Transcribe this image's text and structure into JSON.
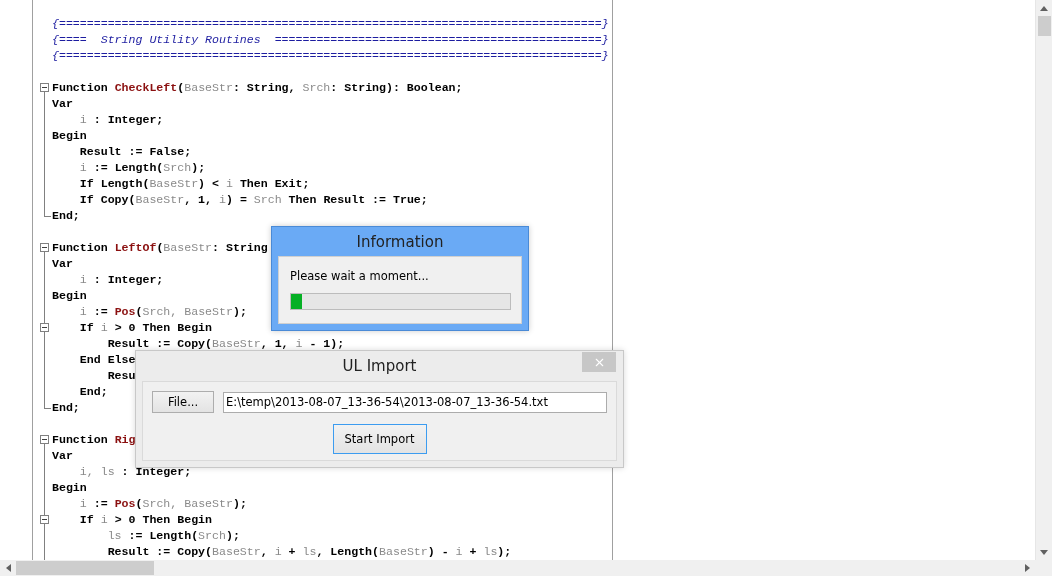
{
  "editor": {
    "lines": [
      {
        "collapsible": false,
        "block_end": false,
        "segments": [
          {
            "kind": "cm",
            "text": "{==============================================================================}"
          }
        ]
      },
      {
        "collapsible": false,
        "block_end": false,
        "segments": [
          {
            "kind": "cm",
            "text": "{====  String Utility Routines  ===============================================}"
          }
        ]
      },
      {
        "collapsible": false,
        "block_end": false,
        "segments": [
          {
            "kind": "cm",
            "text": "{==============================================================================}"
          }
        ]
      },
      {
        "collapsible": false,
        "block_end": false
      },
      {
        "collapsible": true,
        "block_end": false,
        "segments": [
          {
            "kind": "kw",
            "text": "Function "
          },
          {
            "kind": "fn",
            "text": "CheckLeft"
          },
          {
            "kind": "kw",
            "text": "("
          },
          {
            "kind": "id",
            "text": "BaseStr"
          },
          {
            "kind": "kw",
            "text": ": String, "
          },
          {
            "kind": "id",
            "text": "Srch"
          },
          {
            "kind": "kw",
            "text": ": String): Boolean;"
          }
        ]
      },
      {
        "collapsible": false,
        "block_end": false,
        "segments": [
          {
            "kind": "kw",
            "text": "Var"
          }
        ]
      },
      {
        "collapsible": false,
        "block_end": false,
        "segments": [
          {
            "kind": "id",
            "text": "    i"
          },
          {
            "kind": "kw",
            "text": " : Integer;"
          }
        ]
      },
      {
        "collapsible": false,
        "block_end": false,
        "segments": [
          {
            "kind": "kw",
            "text": "Begin"
          }
        ]
      },
      {
        "collapsible": false,
        "block_end": false,
        "segments": [
          {
            "kind": "kw",
            "text": "    Result := False;"
          }
        ]
      },
      {
        "collapsible": false,
        "block_end": false,
        "segments": [
          {
            "kind": "id",
            "text": "    i"
          },
          {
            "kind": "kw",
            "text": " := Length("
          },
          {
            "kind": "id",
            "text": "Srch"
          },
          {
            "kind": "kw",
            "text": ");"
          }
        ]
      },
      {
        "collapsible": false,
        "block_end": false,
        "segments": [
          {
            "kind": "kw",
            "text": "    If Length("
          },
          {
            "kind": "id",
            "text": "BaseStr"
          },
          {
            "kind": "kw",
            "text": ") < "
          },
          {
            "kind": "id",
            "text": "i"
          },
          {
            "kind": "kw",
            "text": " Then Exit;"
          }
        ]
      },
      {
        "collapsible": false,
        "block_end": false,
        "segments": [
          {
            "kind": "kw",
            "text": "    If Copy("
          },
          {
            "kind": "id",
            "text": "BaseStr"
          },
          {
            "kind": "kw",
            "text": ", 1, "
          },
          {
            "kind": "id",
            "text": "i"
          },
          {
            "kind": "kw",
            "text": ") = "
          },
          {
            "kind": "id",
            "text": "Srch"
          },
          {
            "kind": "kw",
            "text": " Then Result := True;"
          }
        ]
      },
      {
        "collapsible": false,
        "block_end": true,
        "segments": [
          {
            "kind": "kw",
            "text": "End;"
          }
        ]
      },
      {
        "collapsible": false,
        "block_end": false
      },
      {
        "collapsible": true,
        "block_end": false,
        "segments": [
          {
            "kind": "kw",
            "text": "Function "
          },
          {
            "kind": "fn",
            "text": "LeftOf"
          },
          {
            "kind": "kw",
            "text": "("
          },
          {
            "kind": "id",
            "text": "BaseStr"
          },
          {
            "kind": "kw",
            "text": ": String"
          }
        ]
      },
      {
        "collapsible": false,
        "block_end": false,
        "segments": [
          {
            "kind": "kw",
            "text": "Var"
          }
        ]
      },
      {
        "collapsible": false,
        "block_end": false,
        "segments": [
          {
            "kind": "id",
            "text": "    i"
          },
          {
            "kind": "kw",
            "text": " : Integer;"
          }
        ]
      },
      {
        "collapsible": false,
        "block_end": false,
        "segments": [
          {
            "kind": "kw",
            "text": "Begin"
          }
        ]
      },
      {
        "collapsible": false,
        "block_end": false,
        "segments": [
          {
            "kind": "id",
            "text": "    i"
          },
          {
            "kind": "kw",
            "text": " := "
          },
          {
            "kind": "fn",
            "text": "Pos"
          },
          {
            "kind": "kw",
            "text": "("
          },
          {
            "kind": "id",
            "text": "Srch, BaseStr"
          },
          {
            "kind": "kw",
            "text": ");"
          }
        ]
      },
      {
        "collapsible": true,
        "block_end": false,
        "segments": [
          {
            "kind": "kw",
            "text": "    If "
          },
          {
            "kind": "id",
            "text": "i"
          },
          {
            "kind": "kw",
            "text": " > 0 Then Begin"
          }
        ]
      },
      {
        "collapsible": false,
        "block_end": false,
        "segments": [
          {
            "kind": "kw",
            "text": "        Result := Copy("
          },
          {
            "kind": "id",
            "text": "BaseStr"
          },
          {
            "kind": "kw",
            "text": ", 1, "
          },
          {
            "kind": "id",
            "text": "i"
          },
          {
            "kind": "kw",
            "text": " - 1);"
          }
        ]
      },
      {
        "collapsible": false,
        "block_end": false,
        "segments": [
          {
            "kind": "kw",
            "text": "    End Else"
          }
        ]
      },
      {
        "collapsible": false,
        "block_end": false,
        "segments": [
          {
            "kind": "kw",
            "text": "        Resu"
          }
        ]
      },
      {
        "collapsible": false,
        "block_end": false,
        "segments": [
          {
            "kind": "kw",
            "text": "    End;"
          }
        ]
      },
      {
        "collapsible": false,
        "block_end": true,
        "segments": [
          {
            "kind": "kw",
            "text": "End;"
          }
        ]
      },
      {
        "collapsible": false,
        "block_end": false
      },
      {
        "collapsible": true,
        "block_end": false,
        "segments": [
          {
            "kind": "kw",
            "text": "Function "
          },
          {
            "kind": "fn",
            "text": "Rig"
          }
        ]
      },
      {
        "collapsible": false,
        "block_end": false,
        "segments": [
          {
            "kind": "kw",
            "text": "Var"
          }
        ]
      },
      {
        "collapsible": false,
        "block_end": false,
        "segments": [
          {
            "kind": "id",
            "text": "    i, ls"
          },
          {
            "kind": "kw",
            "text": " : Integer;"
          }
        ]
      },
      {
        "collapsible": false,
        "block_end": false,
        "segments": [
          {
            "kind": "kw",
            "text": "Begin"
          }
        ]
      },
      {
        "collapsible": false,
        "block_end": false,
        "segments": [
          {
            "kind": "id",
            "text": "    i"
          },
          {
            "kind": "kw",
            "text": " := "
          },
          {
            "kind": "fn",
            "text": "Pos"
          },
          {
            "kind": "kw",
            "text": "("
          },
          {
            "kind": "id",
            "text": "Srch, BaseStr"
          },
          {
            "kind": "kw",
            "text": ");"
          }
        ]
      },
      {
        "collapsible": true,
        "block_end": false,
        "segments": [
          {
            "kind": "kw",
            "text": "    If "
          },
          {
            "kind": "id",
            "text": "i"
          },
          {
            "kind": "kw",
            "text": " > 0 Then Begin"
          }
        ]
      },
      {
        "collapsible": false,
        "block_end": false,
        "segments": [
          {
            "kind": "id",
            "text": "        ls"
          },
          {
            "kind": "kw",
            "text": " := Length("
          },
          {
            "kind": "id",
            "text": "Srch"
          },
          {
            "kind": "kw",
            "text": ");"
          }
        ]
      },
      {
        "collapsible": false,
        "block_end": false,
        "segments": [
          {
            "kind": "kw",
            "text": "        Result := Copy("
          },
          {
            "kind": "id",
            "text": "BaseStr"
          },
          {
            "kind": "kw",
            "text": ", "
          },
          {
            "kind": "id",
            "text": "i"
          },
          {
            "kind": "kw",
            "text": " + "
          },
          {
            "kind": "id",
            "text": "ls"
          },
          {
            "kind": "kw",
            "text": ", Length("
          },
          {
            "kind": "id",
            "text": "BaseStr"
          },
          {
            "kind": "kw",
            "text": ") - "
          },
          {
            "kind": "id",
            "text": "i"
          },
          {
            "kind": "kw",
            "text": " + "
          },
          {
            "kind": "id",
            "text": "ls"
          },
          {
            "kind": "kw",
            "text": ");"
          }
        ]
      }
    ]
  },
  "info_dialog": {
    "title": "Information",
    "message": "Please wait a moment...",
    "progress": {
      "level": 0.05
    }
  },
  "import_dialog": {
    "title": "UL Import",
    "file_button": "File...",
    "path": "E:\\temp\\2013-08-07_13-36-54\\2013-08-07_13-36-54.txt",
    "start_button": "Start Import"
  }
}
